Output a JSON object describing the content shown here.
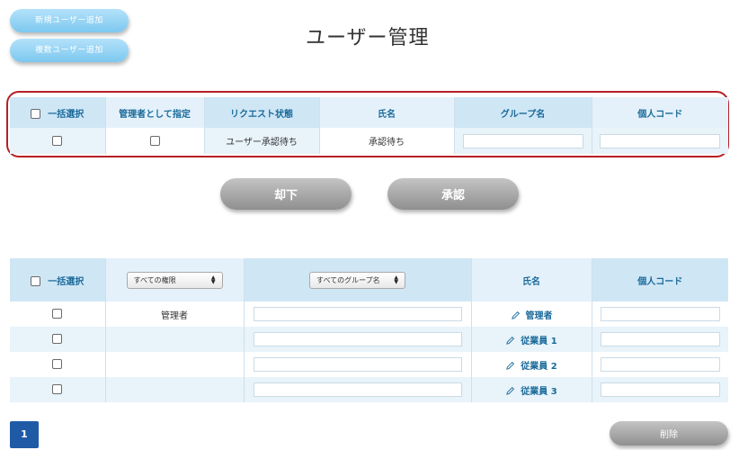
{
  "buttons": {
    "add_user": "新規ユーザー追加",
    "add_multiple_users": "複数ユーザー追加",
    "reject": "却下",
    "approve": "承認",
    "delete": "削除"
  },
  "page_title": "ユーザー管理",
  "request_table": {
    "headers": {
      "select_all": "一括選択",
      "set_admin": "管理者として指定",
      "request_status": "リクエスト状態",
      "name": "氏名",
      "group_name": "グループ名",
      "personal_code": "個人コード"
    },
    "row": {
      "request_status": "ユーザー承認待ち",
      "name": "承認待ち",
      "group_name": "",
      "personal_code": ""
    }
  },
  "user_table": {
    "headers": {
      "select_all": "一括選択",
      "role_filter": "すべての権限",
      "group_filter": "すべてのグループ名",
      "name": "氏名",
      "personal_code": "個人コード"
    },
    "rows": [
      {
        "role": "管理者",
        "name": "管理者"
      },
      {
        "role": "",
        "name": "従業員 1"
      },
      {
        "role": "",
        "name": "従業員 2"
      },
      {
        "role": "",
        "name": "従業員 3"
      }
    ]
  },
  "pagination": {
    "current_page": "1"
  },
  "colors": {
    "accent_blue": "#1a6a9a",
    "highlight_frame": "#b52025",
    "page_button": "#1f5aa6"
  },
  "icons": [
    "checkbox",
    "select-arrows-icon",
    "pencil-icon"
  ]
}
